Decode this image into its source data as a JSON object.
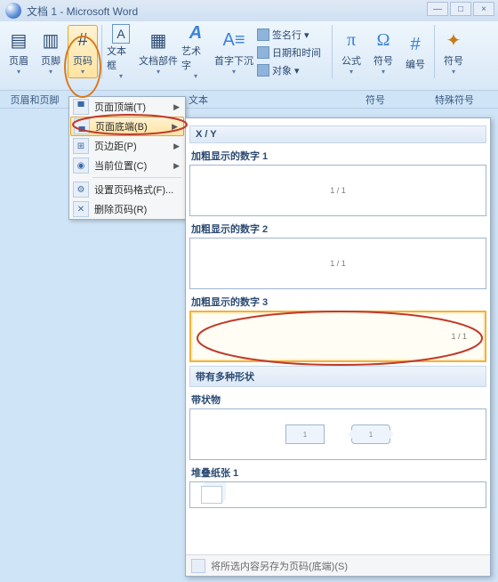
{
  "window": {
    "title": "文档 1 - Microsoft Word"
  },
  "ribbon": {
    "header_btn": "页眉",
    "footer_btn": "页脚",
    "page_number_btn": "页码",
    "textbox_btn": "文本框",
    "quickparts_btn": "文档部件",
    "wordart_btn": "艺术字",
    "dropcap_btn": "首字下沉",
    "sig_line": "签名行",
    "date_time": "日期和时间",
    "object_btn": "对象",
    "equation_btn": "公式",
    "symbol_btn": "符号",
    "number_btn": "编号",
    "special_symbol": "符号"
  },
  "group_labels": {
    "g1": "页眉和页脚",
    "g2": "文本",
    "g3": "符号",
    "g4": "特殊符号"
  },
  "menu": {
    "top": "页面顶端(T)",
    "bottom": "页面底端(B)",
    "margins": "页边距(P)",
    "current": "当前位置(C)",
    "format": "设置页码格式(F)...",
    "remove": "删除页码(R)"
  },
  "gallery": {
    "section1": "X / Y",
    "item1": "加粗显示的数字 1",
    "item2": "加粗显示的数字 2",
    "item3": "加粗显示的数字 3",
    "section2": "带有多种形状",
    "item4": "带状物",
    "item5": "堆叠纸张 1",
    "page_sample": "1 / 1",
    "footer": "将所选内容另存为页码(底端)(S)"
  }
}
